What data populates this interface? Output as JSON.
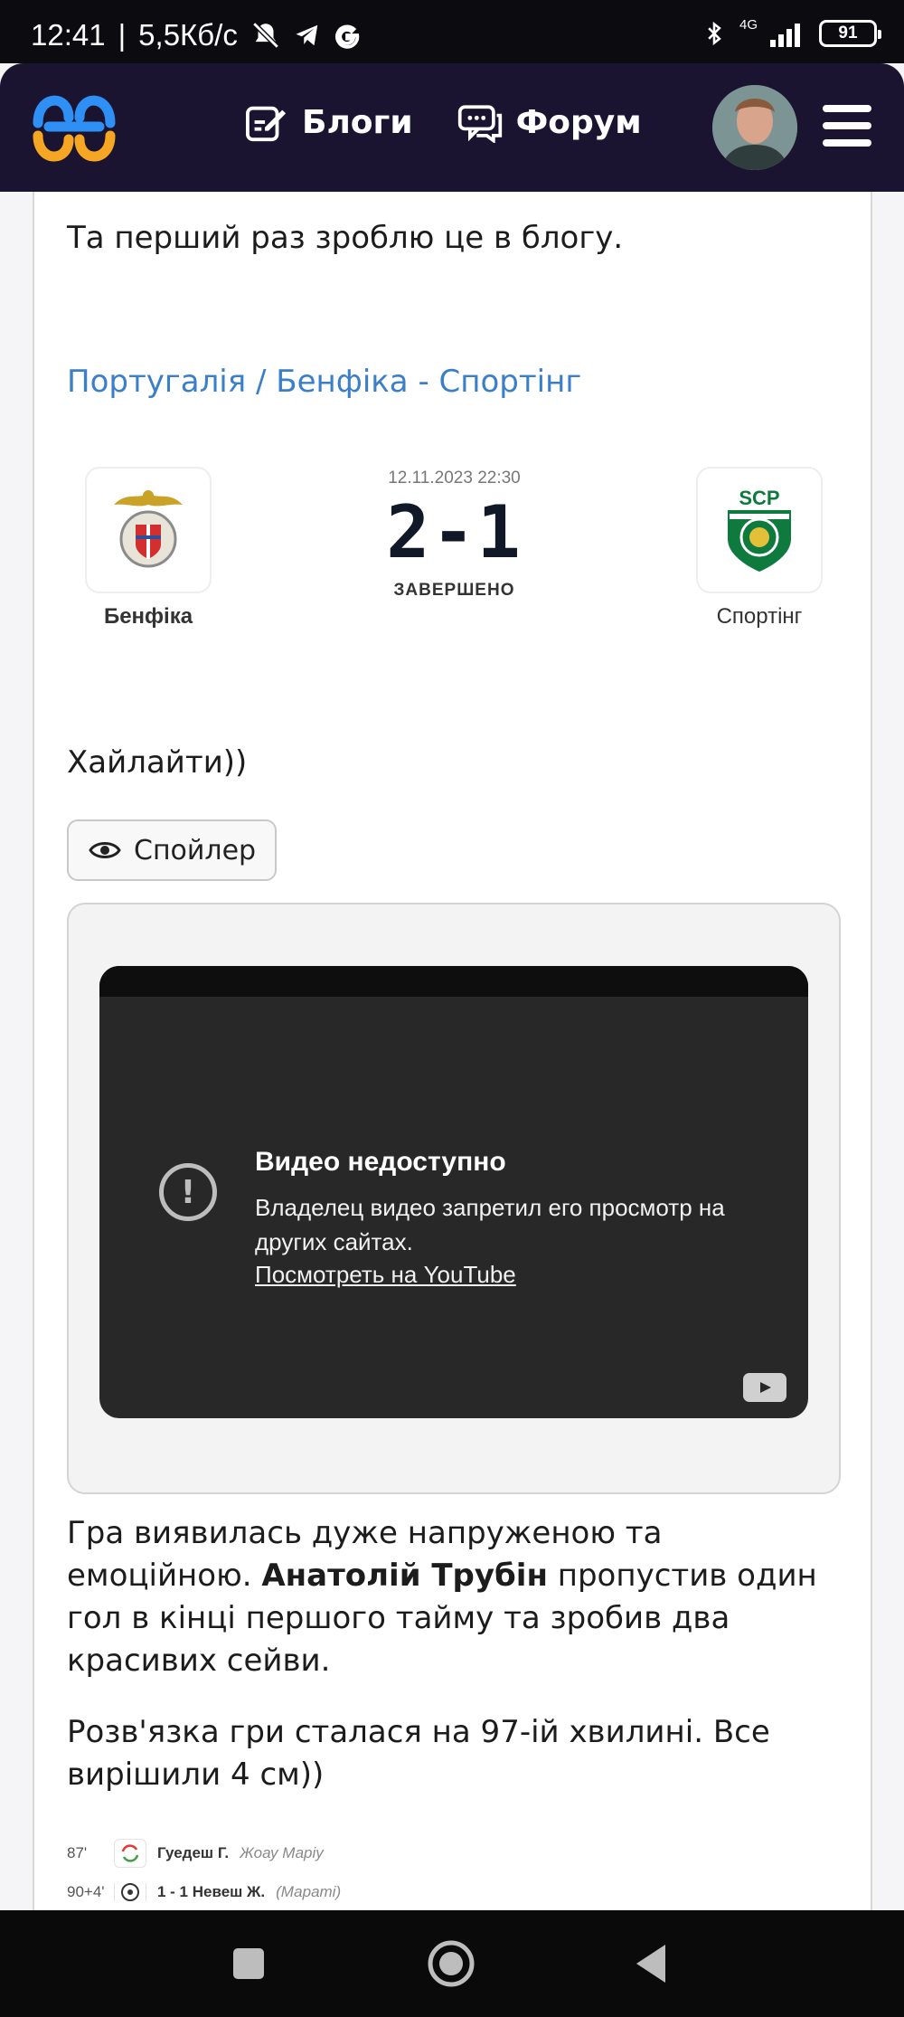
{
  "status_bar": {
    "time": "12:41",
    "speed": "5,5Кб/с",
    "network": "4G",
    "battery": "91"
  },
  "header": {
    "nav": [
      {
        "label": "Блоги",
        "icon": "edit-note-icon"
      },
      {
        "label": "Форум",
        "icon": "chat-icon"
      }
    ],
    "accent_colors": [
      "#2e8ff5",
      "#f5a623"
    ],
    "background": "#1b1430"
  },
  "article": {
    "intro": "Та перший раз зроблю це в блогу.",
    "match_link": "Португалія / Бенфіка - Спортінг",
    "match": {
      "date": "12.11.2023 22:30",
      "score": "2-1",
      "status": "ЗАВЕРШЕНО",
      "home": "Бенфіка",
      "away": "Спортінг"
    },
    "highlights": "Хайлайти))",
    "spoiler_label": "Спойлер",
    "video": {
      "title": "Видео недоступно",
      "message": "Владелец видео запретил его просмотр на других сайтах.",
      "link": "Посмотреть на YouTube"
    },
    "para1_a": "Гра виявилась дуже напруженою та емоційною. ",
    "para1_bold": "Анатолій Трубін",
    "para1_b": " пропустив один гол в кінці першого тайму та зробив два красивих сейви.",
    "para2": "Розв'язка гри сталася на 97-ій хвилині. Все вирішили 4 см))",
    "events": [
      {
        "minute": "87'",
        "icon": "substitution-icon",
        "player": "Гуедеш Г.",
        "assist": "Жоау Маріу"
      },
      {
        "minute": "90+4'",
        "icon": "ball-icon",
        "player": "1 - 1   Невеш Ж.",
        "assist": "(Мараті)"
      }
    ]
  }
}
